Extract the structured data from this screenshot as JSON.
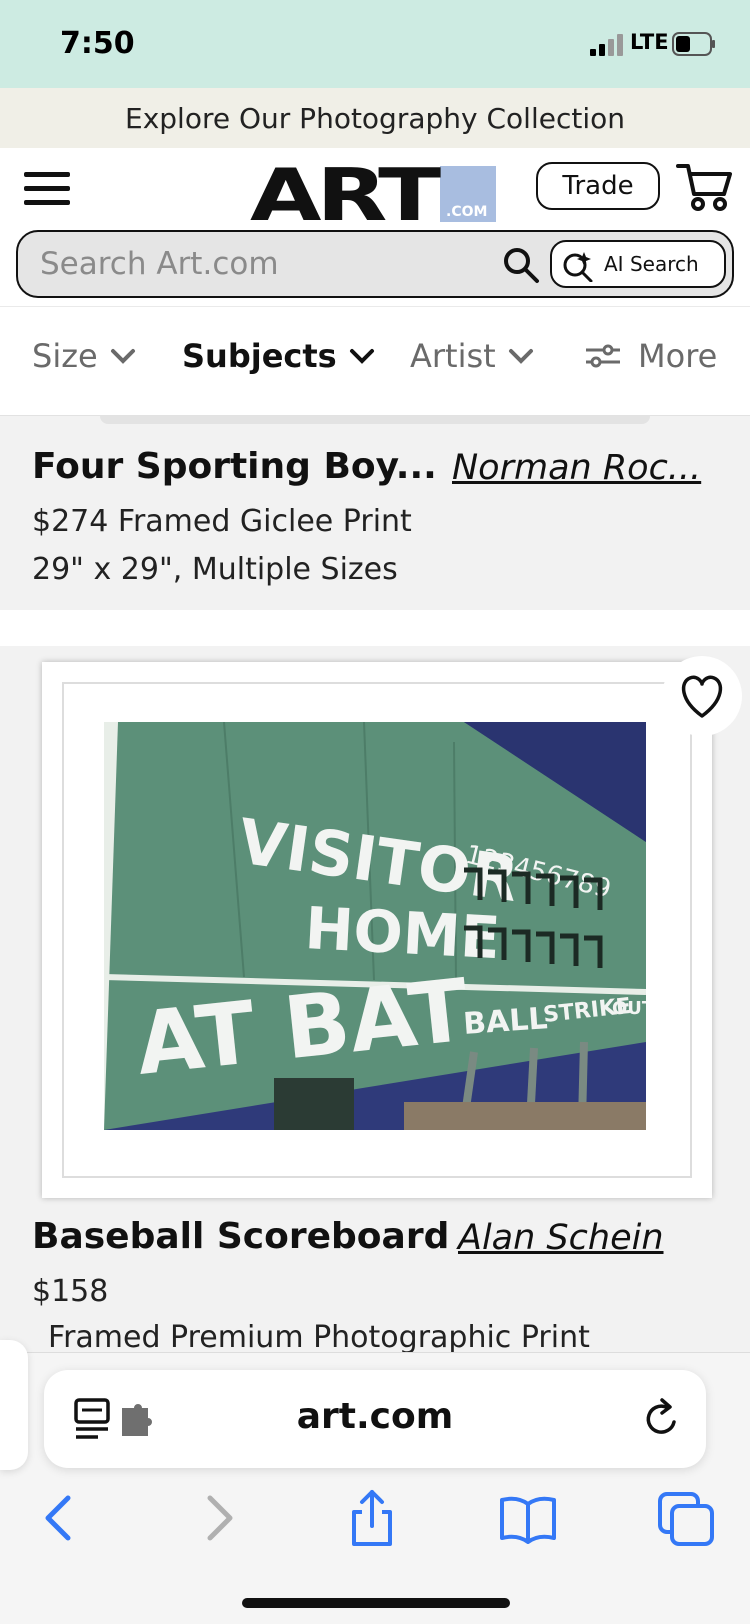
{
  "status": {
    "time": "7:50",
    "network": "LTE"
  },
  "promo": {
    "text": "Explore Our Photography Collection"
  },
  "header": {
    "logo_text": "ART",
    "logo_suffix": ".COM",
    "trade_label": "Trade"
  },
  "search": {
    "placeholder": "Search Art.com",
    "ai_label": "AI Search"
  },
  "filters": [
    {
      "label": "Size",
      "active": false
    },
    {
      "label": "Subjects",
      "active": true
    },
    {
      "label": "Artist",
      "active": false
    },
    {
      "label": "More",
      "active": false
    }
  ],
  "products": [
    {
      "title": "Four Sporting Boy...",
      "artist": "Norman Roc...",
      "price_line": "$274  Framed Giclee Print",
      "size_line": "29\" x 29\", Multiple Sizes"
    },
    {
      "title": "Baseball Scoreboard",
      "artist": "Alan Schein",
      "price_line": "$158",
      "type_line": "Framed Premium Photographic Print",
      "photo_text": {
        "line1": "VISITOR",
        "line2": "HOME",
        "line3": "AT BAT",
        "innings": "123456789",
        "ball": "BALL",
        "strike": "STRIKE",
        "out": "OUT"
      }
    }
  ],
  "browser": {
    "url": "art.com"
  },
  "colors": {
    "status_bg": "#cdebe2",
    "promo_bg": "#f0efe7",
    "logo_blue": "#a8bde0",
    "ios_blue": "#3478f6",
    "scoreboard_green": "#5c9079",
    "sky": "#2f3a7a"
  }
}
